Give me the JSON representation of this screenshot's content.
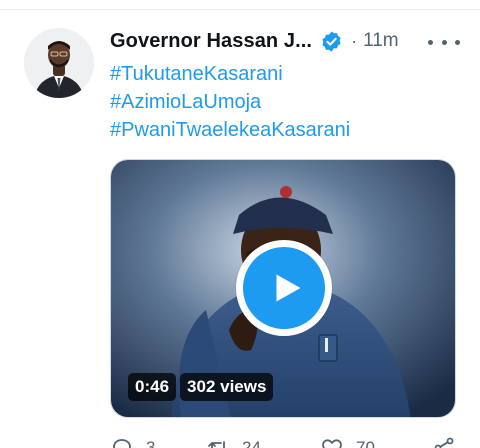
{
  "tweet": {
    "author_name": "Governor Hassan J...",
    "separator": "·",
    "time": "11m",
    "hashtags": [
      "#TukutaneKasarani",
      "#AzimioLaUmoja",
      "#PwaniTwaelekeaKasarani"
    ]
  },
  "video": {
    "duration": "0:46",
    "views": "302 views"
  },
  "actions": {
    "reply_count": "3",
    "retweet_count": "24",
    "like_count": "70"
  },
  "colors": {
    "accent": "#1d9bf0",
    "muted": "#536471",
    "text": "#0f1419"
  },
  "icons": {
    "verified": "verified-badge-icon",
    "more": "more-dots-icon",
    "play": "play-icon",
    "reply": "reply-icon",
    "retweet": "retweet-icon",
    "like": "heart-icon",
    "share": "share-icon"
  }
}
